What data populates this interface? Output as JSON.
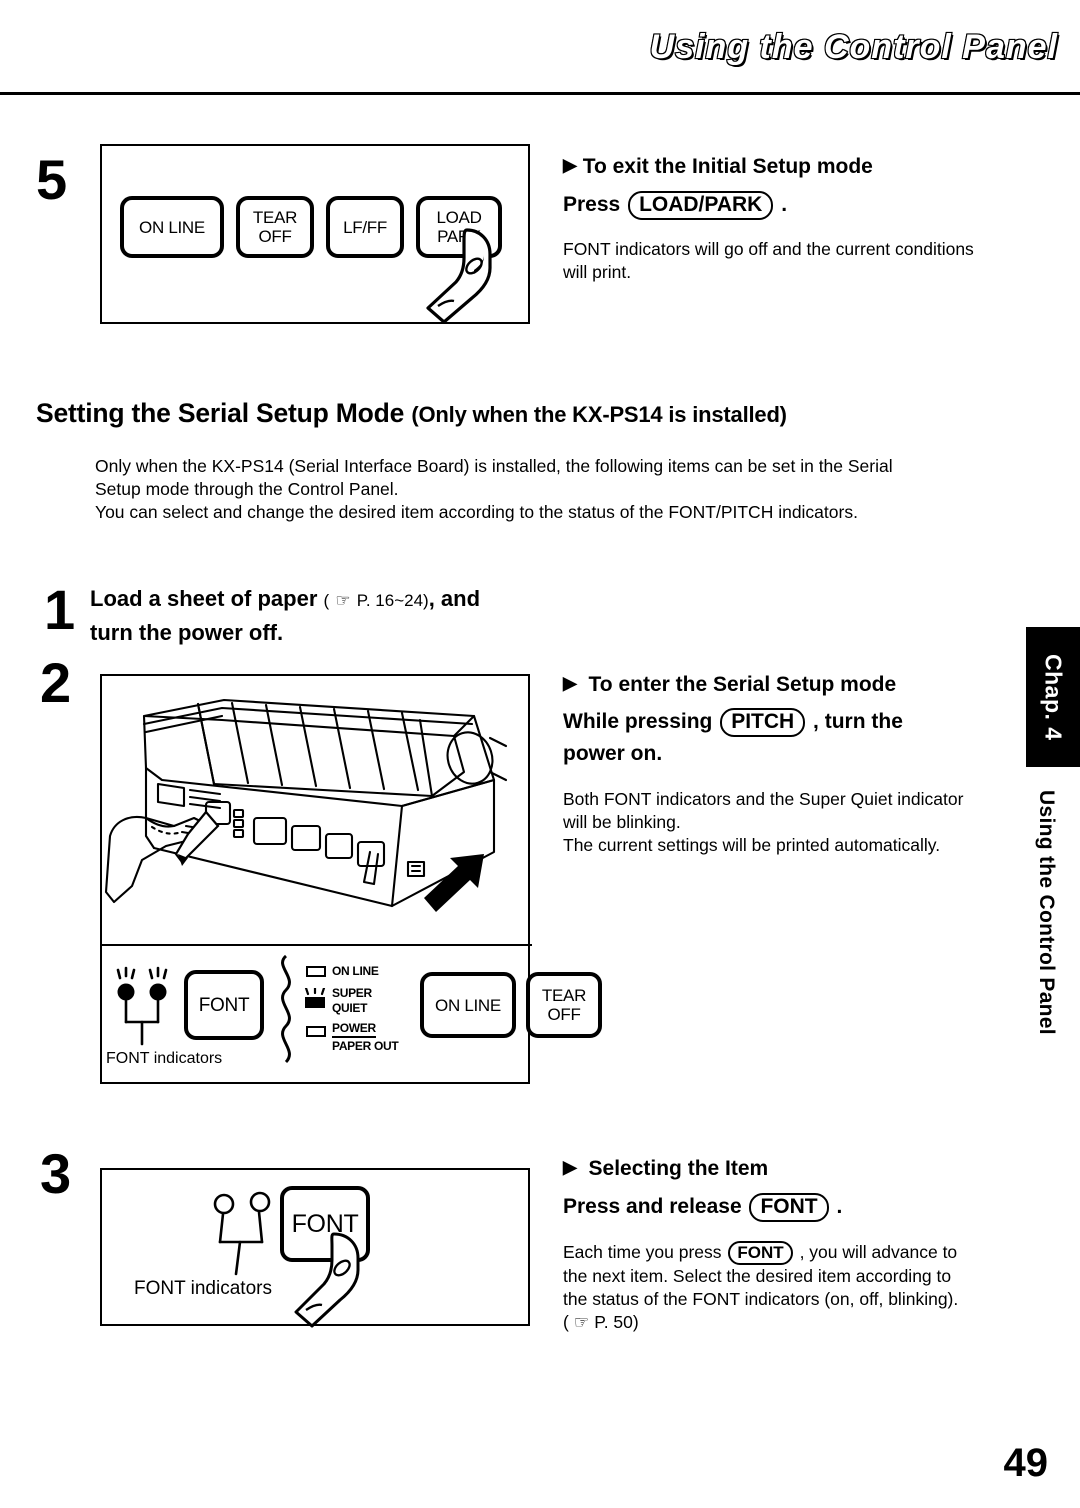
{
  "header": {
    "title": "Using the Control Panel"
  },
  "page_number": "49",
  "side_tab": {
    "chapter": "Chap. 4",
    "chapter_title": "Using the Control Panel"
  },
  "step5": {
    "number": "5",
    "panel_buttons": [
      {
        "label_line1": "ON LINE",
        "label_line2": ""
      },
      {
        "label_line1": "TEAR",
        "label_line2": "OFF"
      },
      {
        "label_line1": "LF/FF",
        "label_line2": ""
      },
      {
        "label_line1": "LOAD",
        "label_line2": "PARK"
      }
    ],
    "heading": "To exit the Initial Setup mode",
    "press_label": "Press",
    "key": "LOAD/PARK",
    "period": ".",
    "body_line1": "FONT indicators will go off and the current conditions",
    "body_line2": "will print."
  },
  "section": {
    "title_main": "Setting the Serial Setup Mode",
    "title_sub": "(Only when the KX-PS14 is installed)",
    "para_line1": "Only when the KX-PS14 (Serial Interface Board) is installed, the following items can be set in the Serial",
    "para_line2": "Setup mode through the Control Panel.",
    "para_line3": "You can select and change the desired item according to the status of the FONT/PITCH indicators."
  },
  "step1": {
    "number": "1",
    "text_a": "Load a sheet of paper",
    "ref_open": "(",
    "ref_icon": "☞",
    "ref_page": "P. 16~24)",
    "text_b": ", and",
    "text_line2": "turn the power off."
  },
  "step2": {
    "number": "2",
    "heading": "To enter the Serial Setup mode",
    "line_a": "While   pressing",
    "key": "PITCH",
    "line_b": ",  turn  the",
    "line_c": "power on.",
    "body_line1": "Both FONT indicators and the Super Quiet indicator",
    "body_line2": "will be blinking.",
    "body_line3": "The current settings will be printed automatically.",
    "detail": {
      "font_indicators_caption": "FONT indicators",
      "font_button": "FONT",
      "indicators": [
        {
          "label_line1": "ON LINE",
          "label_line2": "",
          "state": "off"
        },
        {
          "label_line1": "SUPER",
          "label_line2": "QUIET",
          "state": "blinking"
        },
        {
          "label_line1": "POWER",
          "label_line2": "PAPER OUT",
          "state": "off"
        }
      ],
      "buttons": [
        {
          "label_line1": "ON LINE",
          "label_line2": ""
        },
        {
          "label_line1": "TEAR",
          "label_line2": "OFF"
        }
      ]
    }
  },
  "step3": {
    "number": "3",
    "font_button": "FONT",
    "font_indicators_caption": "FONT indicators",
    "heading": "Selecting the Item",
    "press_label": "Press and release",
    "key": "FONT",
    "period": ".",
    "body_part1": "Each time you press",
    "body_key": "FONT",
    "body_part2": ", you will advance to",
    "body_line2": "the next item. Select the desired item according to",
    "body_line3": "the status of the FONT indicators (on, off, blinking).",
    "body_ref_open": "(",
    "body_ref_icon": "☞",
    "body_ref_page": "P. 50)"
  }
}
